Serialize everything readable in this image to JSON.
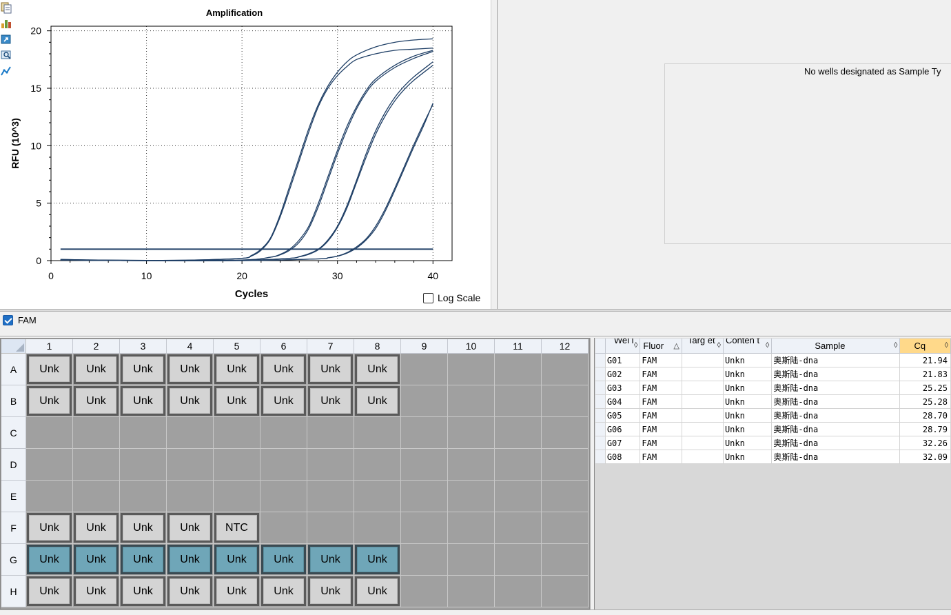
{
  "chart": {
    "title": "Amplification",
    "xlabel": "Cycles",
    "ylabel": "RFU (10^3)",
    "log_scale_label": "Log Scale",
    "x_ticks": [
      "0",
      "10",
      "20",
      "30",
      "40"
    ],
    "y_ticks": [
      "0",
      "5",
      "10",
      "15",
      "20"
    ]
  },
  "chart_data": {
    "type": "line",
    "xlabel": "Cycles",
    "ylabel": "RFU (10^3)",
    "xlim": [
      0,
      42
    ],
    "ylim": [
      0,
      20.4
    ],
    "grid": true,
    "threshold": 1.0,
    "series": [
      {
        "x": [
          1,
          5,
          10,
          15,
          20,
          21,
          22,
          23,
          24,
          25,
          26,
          27,
          28,
          29,
          30,
          31,
          32,
          34,
          36,
          38,
          40
        ],
        "y": [
          0.1,
          0.05,
          0.02,
          0.05,
          0.2,
          0.45,
          1.0,
          2.0,
          4.0,
          6.5,
          9.0,
          11.5,
          13.6,
          15.2,
          16.4,
          17.3,
          17.9,
          18.6,
          19.0,
          19.2,
          19.3
        ]
      },
      {
        "x": [
          1,
          5,
          10,
          15,
          20,
          21,
          22,
          23,
          24,
          25,
          26,
          27,
          28,
          29,
          30,
          31,
          32,
          34,
          36,
          38,
          40
        ],
        "y": [
          0.1,
          0.05,
          0.02,
          0.05,
          0.2,
          0.4,
          0.9,
          1.9,
          3.8,
          6.2,
          8.7,
          11.2,
          13.4,
          15.0,
          16.1,
          16.9,
          17.5,
          18.0,
          18.3,
          18.4,
          18.5
        ]
      },
      {
        "x": [
          1,
          10,
          20,
          23,
          24,
          25,
          26,
          27,
          28,
          29,
          30,
          31,
          32,
          33,
          34,
          36,
          38,
          40
        ],
        "y": [
          0.05,
          0.0,
          0.05,
          0.3,
          0.55,
          1.0,
          1.8,
          3.0,
          5.0,
          7.3,
          9.6,
          11.7,
          13.4,
          14.8,
          15.8,
          17.0,
          17.8,
          18.3
        ]
      },
      {
        "x": [
          1,
          10,
          20,
          23,
          24,
          25,
          26,
          27,
          28,
          29,
          30,
          31,
          32,
          33,
          34,
          36,
          38,
          40
        ],
        "y": [
          0.05,
          0.0,
          0.05,
          0.3,
          0.5,
          0.9,
          1.6,
          2.8,
          4.7,
          7.0,
          9.3,
          11.4,
          13.2,
          14.6,
          15.6,
          16.8,
          17.6,
          18.2
        ]
      },
      {
        "x": [
          1,
          10,
          20,
          25,
          26,
          27,
          28,
          29,
          30,
          31,
          32,
          33,
          34,
          35,
          36,
          37,
          38,
          40
        ],
        "y": [
          0.05,
          0.0,
          0.02,
          0.2,
          0.35,
          0.6,
          1.0,
          1.8,
          3.0,
          4.8,
          7.0,
          9.3,
          11.3,
          12.9,
          14.2,
          15.2,
          16.0,
          17.3
        ]
      },
      {
        "x": [
          1,
          10,
          20,
          25,
          26,
          27,
          28,
          29,
          30,
          31,
          32,
          33,
          34,
          35,
          36,
          37,
          38,
          40
        ],
        "y": [
          0.05,
          0.0,
          0.02,
          0.2,
          0.33,
          0.55,
          0.95,
          1.7,
          2.9,
          4.6,
          6.8,
          9.0,
          11.0,
          12.6,
          13.9,
          14.9,
          15.7,
          17.0
        ]
      },
      {
        "x": [
          1,
          10,
          20,
          28,
          29,
          30,
          31,
          32,
          33,
          34,
          35,
          36,
          37,
          38,
          39,
          40
        ],
        "y": [
          0.05,
          0.0,
          0.0,
          0.15,
          0.25,
          0.4,
          0.7,
          1.2,
          1.9,
          3.0,
          4.5,
          6.3,
          8.2,
          10.1,
          11.9,
          13.6
        ]
      },
      {
        "x": [
          1,
          10,
          20,
          28,
          29,
          30,
          31,
          32,
          33,
          34,
          35,
          36,
          37,
          38,
          39,
          40
        ],
        "y": [
          0.05,
          0.0,
          0.0,
          0.15,
          0.24,
          0.38,
          0.65,
          1.1,
          1.8,
          2.8,
          4.3,
          6.1,
          8.0,
          9.9,
          11.7,
          13.7
        ]
      }
    ]
  },
  "right_panel": {
    "message": "No wells designated as Sample Ty"
  },
  "fluor_selector": {
    "label": "FAM",
    "checked": true
  },
  "plate": {
    "columns": [
      "1",
      "2",
      "3",
      "4",
      "5",
      "6",
      "7",
      "8",
      "9",
      "10",
      "11",
      "12"
    ],
    "rows": [
      {
        "label": "A",
        "wells": [
          "Unk",
          "Unk",
          "Unk",
          "Unk",
          "Unk",
          "Unk",
          "Unk",
          "Unk",
          "",
          "",
          "",
          ""
        ]
      },
      {
        "label": "B",
        "wells": [
          "Unk",
          "Unk",
          "Unk",
          "Unk",
          "Unk",
          "Unk",
          "Unk",
          "Unk",
          "",
          "",
          "",
          ""
        ]
      },
      {
        "label": "C",
        "wells": [
          "",
          "",
          "",
          "",
          "",
          "",
          "",
          "",
          "",
          "",
          "",
          ""
        ]
      },
      {
        "label": "D",
        "wells": [
          "",
          "",
          "",
          "",
          "",
          "",
          "",
          "",
          "",
          "",
          "",
          ""
        ]
      },
      {
        "label": "E",
        "wells": [
          "",
          "",
          "",
          "",
          "",
          "",
          "",
          "",
          "",
          "",
          "",
          ""
        ]
      },
      {
        "label": "F",
        "wells": [
          "Unk",
          "Unk",
          "Unk",
          "Unk",
          "NTC",
          "",
          "",
          "",
          "",
          "",
          "",
          ""
        ]
      },
      {
        "label": "G",
        "wells": [
          "Unk",
          "Unk",
          "Unk",
          "Unk",
          "Unk",
          "Unk",
          "Unk",
          "Unk",
          "",
          "",
          "",
          ""
        ],
        "selected": true
      },
      {
        "label": "H",
        "wells": [
          "Unk",
          "Unk",
          "Unk",
          "Unk",
          "Unk",
          "Unk",
          "Unk",
          "Unk",
          "",
          "",
          "",
          ""
        ]
      }
    ],
    "colors": {
      "empty": "#a0a0a0",
      "unk": "#d4d4d4",
      "selected": "#6fa6b8"
    }
  },
  "results_table": {
    "headers": {
      "well": "Wel l",
      "fluor": "Fluor",
      "target": "Targ et",
      "content": "Conten t",
      "sample": "Sample",
      "cq": "Cq"
    },
    "rows": [
      {
        "well": "G01",
        "fluor": "FAM",
        "target": "",
        "content": "Unkn",
        "sample": "奥斯陆-dna",
        "cq": "21.94"
      },
      {
        "well": "G02",
        "fluor": "FAM",
        "target": "",
        "content": "Unkn",
        "sample": "奥斯陆-dna",
        "cq": "21.83"
      },
      {
        "well": "G03",
        "fluor": "FAM",
        "target": "",
        "content": "Unkn",
        "sample": "奥斯陆-dna",
        "cq": "25.25"
      },
      {
        "well": "G04",
        "fluor": "FAM",
        "target": "",
        "content": "Unkn",
        "sample": "奥斯陆-dna",
        "cq": "25.28"
      },
      {
        "well": "G05",
        "fluor": "FAM",
        "target": "",
        "content": "Unkn",
        "sample": "奥斯陆-dna",
        "cq": "28.70"
      },
      {
        "well": "G06",
        "fluor": "FAM",
        "target": "",
        "content": "Unkn",
        "sample": "奥斯陆-dna",
        "cq": "28.79"
      },
      {
        "well": "G07",
        "fluor": "FAM",
        "target": "",
        "content": "Unkn",
        "sample": "奥斯陆-dna",
        "cq": "32.26"
      },
      {
        "well": "G08",
        "fluor": "FAM",
        "target": "",
        "content": "Unkn",
        "sample": "奥斯陆-dna",
        "cq": "32.09"
      }
    ]
  }
}
